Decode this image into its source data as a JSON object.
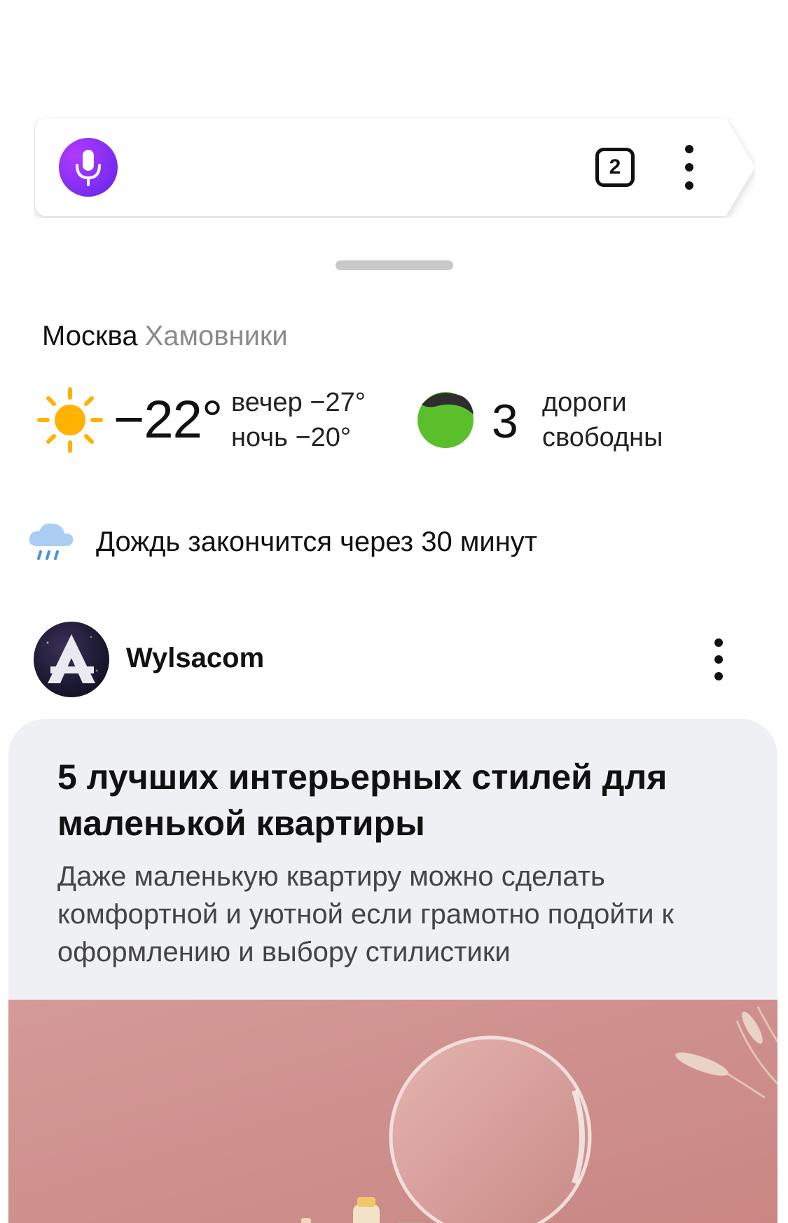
{
  "search_bar": {
    "tabs_count": "2",
    "alice_icon": "microphone-icon",
    "menu_icon": "more-vertical-icon"
  },
  "location": {
    "city": "Москва",
    "district": "Хамовники"
  },
  "weather": {
    "icon": "sun-icon",
    "current_temp": "−22°",
    "evening": "вечер −27°",
    "night": "ночь −20°"
  },
  "traffic": {
    "icon": "traffic-light-icon",
    "score": "3",
    "line1": "дороги",
    "line2": "свободны",
    "color": "#5bbf2b"
  },
  "rain": {
    "icon": "rain-cloud-icon",
    "text": "Дождь закончится через 30 минут"
  },
  "feed": {
    "source_name": "Wylsacom",
    "source_avatar_letter": "A",
    "card": {
      "title": "5 лучших интерьерных стилей для маленькой квартиры",
      "subtitle": "Даже маленькую квартиру можно сделать комфортной и уютной если грамотно подойти к оформлению и выбору стилистики"
    }
  },
  "colors": {
    "alice_purple": "#8a2ff0",
    "card_bg": "#eff0f3",
    "sun": "#ffb300"
  }
}
